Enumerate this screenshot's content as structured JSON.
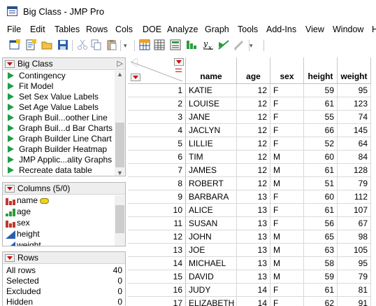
{
  "window": {
    "title": "Big Class - JMP Pro"
  },
  "menu": [
    "File",
    "Edit",
    "Tables",
    "Rows",
    "Cols",
    "DOE",
    "Analyze",
    "Graph",
    "Tools",
    "Add-Ins",
    "View",
    "Window",
    "H"
  ],
  "toolbar": {
    "icons": [
      "new-data-table-icon",
      "new-script-icon",
      "open-icon",
      "save-icon",
      "cut-icon",
      "copy-icon",
      "paste-icon",
      "data-grid-icon",
      "table-icon",
      "summary-icon",
      "distribution-icon",
      "fit-y-by-x-icon",
      "fit-model-icon",
      "edit-icon"
    ],
    "more_glyph": "▾"
  },
  "table_panel": {
    "title": "Big Class",
    "expand_glyph": "▷",
    "scripts": [
      "Contingency",
      "Fit Model",
      "Set Sex Value Labels",
      "Set Age Value Labels",
      "Graph Buil...oother Line",
      "Graph Buil...d Bar Charts",
      "Graph Builder Line Chart",
      "Graph Builder Heatmap",
      "JMP Applic...ality Graphs",
      "Recreate data table"
    ]
  },
  "columns_panel": {
    "title": "Columns (5/0)",
    "columns": [
      {
        "name": "name",
        "type": "nominal",
        "key_icon": true
      },
      {
        "name": "age",
        "type": "ordinal"
      },
      {
        "name": "sex",
        "type": "nominal"
      },
      {
        "name": "height",
        "type": "continuous"
      },
      {
        "name": "weight",
        "type": "continuous"
      }
    ]
  },
  "rows_panel": {
    "title": "Rows",
    "stats": [
      {
        "label": "All rows",
        "value": "40"
      },
      {
        "label": "Selected",
        "value": "0"
      },
      {
        "label": "Excluded",
        "value": "0"
      },
      {
        "label": "Hidden",
        "value": "0"
      }
    ]
  },
  "grid": {
    "headers": [
      "name",
      "age",
      "sex",
      "height",
      "weight"
    ],
    "rows": [
      [
        "1",
        "KATIE",
        "12",
        "F",
        "59",
        "95"
      ],
      [
        "2",
        "LOUISE",
        "12",
        "F",
        "61",
        "123"
      ],
      [
        "3",
        "JANE",
        "12",
        "F",
        "55",
        "74"
      ],
      [
        "4",
        "JACLYN",
        "12",
        "F",
        "66",
        "145"
      ],
      [
        "5",
        "LILLIE",
        "12",
        "F",
        "52",
        "64"
      ],
      [
        "6",
        "TIM",
        "12",
        "M",
        "60",
        "84"
      ],
      [
        "7",
        "JAMES",
        "12",
        "M",
        "61",
        "128"
      ],
      [
        "8",
        "ROBERT",
        "12",
        "M",
        "51",
        "79"
      ],
      [
        "9",
        "BARBARA",
        "13",
        "F",
        "60",
        "112"
      ],
      [
        "10",
        "ALICE",
        "13",
        "F",
        "61",
        "107"
      ],
      [
        "11",
        "SUSAN",
        "13",
        "F",
        "56",
        "67"
      ],
      [
        "12",
        "JOHN",
        "13",
        "M",
        "65",
        "98"
      ],
      [
        "13",
        "JOE",
        "13",
        "M",
        "63",
        "105"
      ],
      [
        "14",
        "MICHAEL",
        "13",
        "M",
        "58",
        "95"
      ],
      [
        "15",
        "DAVID",
        "13",
        "M",
        "59",
        "79"
      ],
      [
        "16",
        "JUDY",
        "14",
        "F",
        "61",
        "81"
      ],
      [
        "17",
        "ELIZABETH",
        "14",
        "F",
        "62",
        "91"
      ]
    ]
  },
  "colors": {
    "accent_red": "#d00000",
    "play_green": "#1e9e46",
    "nominal_red": "#c0392b",
    "ordinal_green": "#2e9d3e",
    "continuous_blue": "#2a5db0"
  }
}
